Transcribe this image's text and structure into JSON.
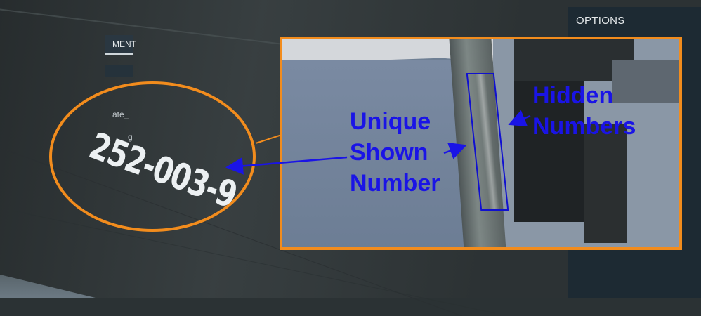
{
  "options_panel": {
    "title": "OPTIONS",
    "tab_label": "MENT",
    "row_text_1": "ate_",
    "row_text_2": "g"
  },
  "callout": {
    "hull_number": "252-003-9"
  },
  "inset": {
    "unique_label_lines": [
      "Unique",
      "Shown",
      "Number"
    ],
    "hidden_label_lines": [
      "Hidden",
      "Numbers"
    ]
  },
  "colors": {
    "accent_orange": "#f28c1d",
    "annotation_blue": "#1a14e6",
    "panel_bg": "#1d2a33"
  }
}
